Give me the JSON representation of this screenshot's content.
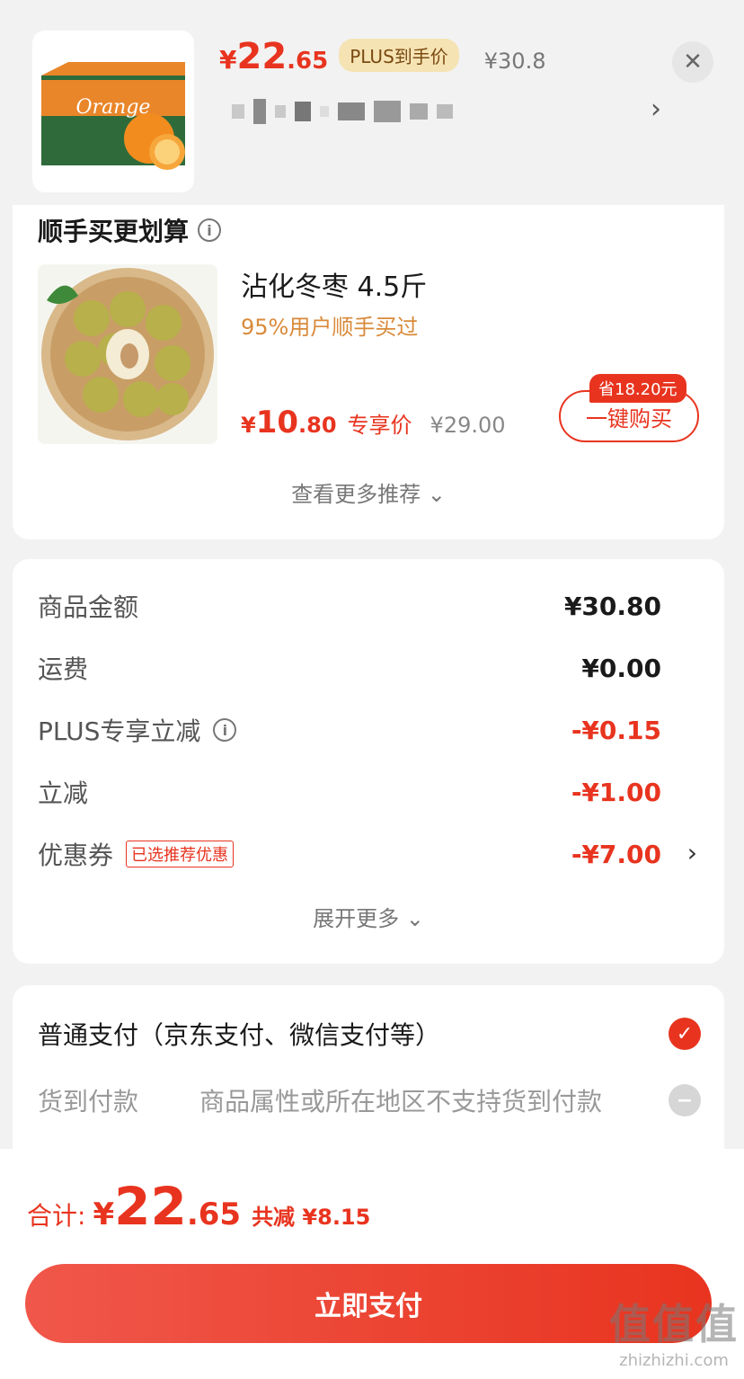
{
  "header": {
    "price_yen": "¥",
    "price_int": "22",
    "price_dec": ".65",
    "plus_tag": "PLUS到手价",
    "orig_price": "¥30.8",
    "close_icon": "close-icon",
    "chevron": "›"
  },
  "recommend": {
    "title": "顺手买更划算",
    "info_icon": "i",
    "product_name": "沾化冬枣 4.5斤",
    "product_sub": "95%用户顺手买过",
    "price_yen": "¥",
    "price_int": "10",
    "price_dec": ".80",
    "exclusive_label": "专享价",
    "orig_price": "¥29.00",
    "save_tag": "省18.20元",
    "buy_button": "一键购买",
    "see_more": "查看更多推荐 ⌄"
  },
  "summary": {
    "rows": [
      {
        "label": "商品金额",
        "value": "¥30.80"
      },
      {
        "label": "运费",
        "value": "¥0.00"
      },
      {
        "label": "PLUS专享立减",
        "value": "-¥0.15"
      },
      {
        "label": "立减",
        "value": "-¥1.00"
      },
      {
        "label": "优惠券",
        "tag": "已选推荐优惠",
        "value": "-¥7.00",
        "chevron": "›"
      }
    ],
    "expand": "展开更多 ⌄"
  },
  "payment": {
    "normal_label": "普通支付（京东支付、微信支付等）",
    "normal_check": "✓",
    "cod_label": "货到付款",
    "cod_note": "商品属性或所在地区不支持货到付款",
    "cod_icon": "−"
  },
  "bottom": {
    "total_label": "合计:",
    "total_yen": "¥",
    "total_int": "22",
    "total_dec": ".65",
    "reduce": "共减 ¥8.15",
    "pay_button": "立即支付",
    "watermark_big": "值值值",
    "watermark_small": "zhizhizhi.com"
  },
  "colors": {
    "accent": "#e8341f",
    "plus_bg": "#f6e3b4",
    "sub_orange": "#d98a3a"
  }
}
